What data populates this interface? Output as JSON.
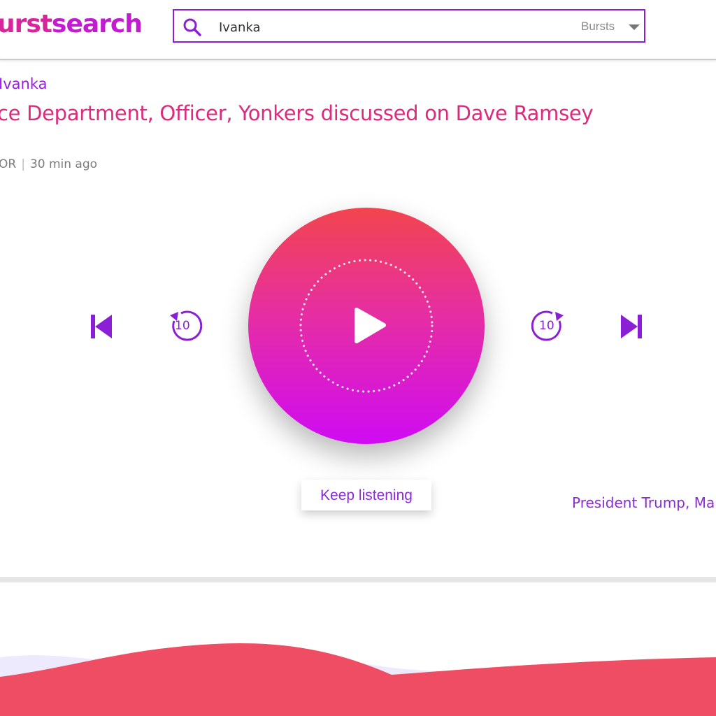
{
  "header": {
    "logo_part1": "urst",
    "logo_part2": "search",
    "search": {
      "value": "Ivanka",
      "placeholder": ""
    },
    "filter": {
      "selected": "Bursts"
    }
  },
  "burst": {
    "tag": "Ivanka",
    "headline": "ce Department, Officer, Yonkers discussed on Dave Ramsey",
    "source": "OR",
    "time": "30 min ago"
  },
  "player": {
    "rewind_seconds": "10",
    "forward_seconds": "10",
    "keep_listening_label": "Keep listening"
  },
  "side_topics": "President Trump, Ma",
  "colors": {
    "accent_purple": "#8a1fd6",
    "headline_pink": "#dc2a7c",
    "gradient_top": "#f2454e",
    "gradient_bottom": "#cf0bf3",
    "wave_red": "#ef4d63",
    "wave_lavender": "#eeeafd"
  },
  "icons": {
    "search": "search-icon",
    "previous": "skip-back-icon",
    "rewind": "rewind-10-icon",
    "play": "play-icon",
    "forward": "forward-10-icon",
    "next": "skip-forward-icon",
    "dropdown": "chevron-down-icon"
  }
}
